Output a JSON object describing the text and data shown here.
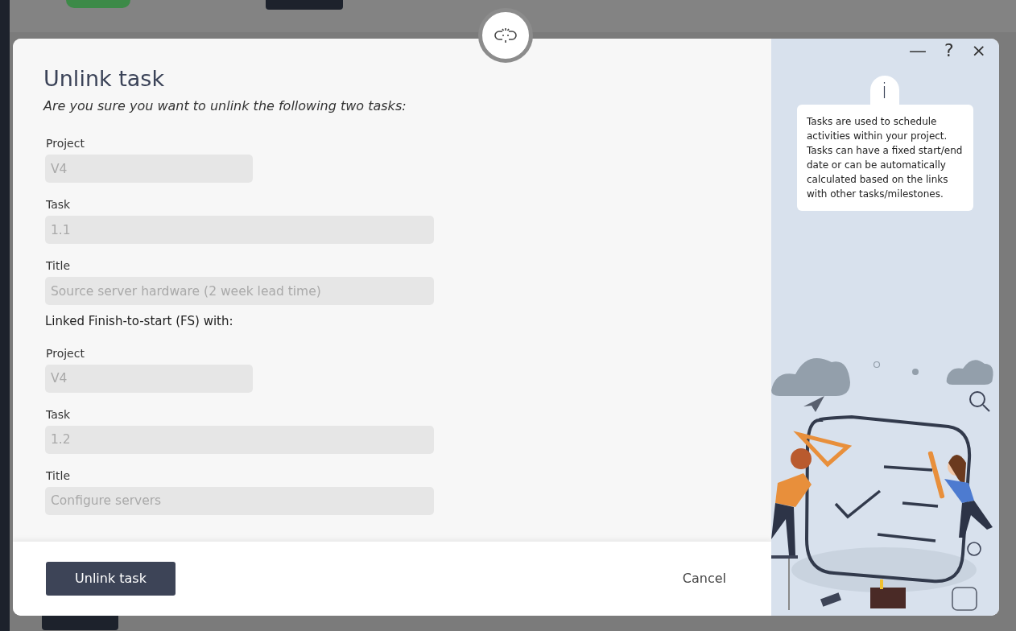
{
  "dialog": {
    "title": "Unlink task",
    "subtitle": "Are you sure you want to unlink the following two tasks:",
    "items": [
      {
        "kind": "short_field",
        "label": "Project",
        "value": "V4",
        "disabled": true
      },
      {
        "kind": "field",
        "label": "Task",
        "value": "1.1",
        "disabled": true
      },
      {
        "kind": "field",
        "label": "Title",
        "value": "Source server hardware (2 week lead time)",
        "disabled": true
      },
      {
        "kind": "note",
        "text": "Linked Finish-to-start (FS) with:"
      },
      {
        "kind": "short_field",
        "label": "Project",
        "value": "V4",
        "disabled": true
      },
      {
        "kind": "field",
        "label": "Task",
        "value": "1.2",
        "disabled": true
      },
      {
        "kind": "field",
        "label": "Title",
        "value": "Configure servers",
        "disabled": true
      }
    ],
    "primary_button": "Unlink task",
    "cancel_button": "Cancel",
    "window_controls": [
      "—",
      "?",
      "×"
    ],
    "info": {
      "icon": "i",
      "text": "Tasks are used to schedule activities within your project. Tasks can have a fixed start/end date or can be automatically calculated based on the links with other tasks/milestones."
    }
  }
}
